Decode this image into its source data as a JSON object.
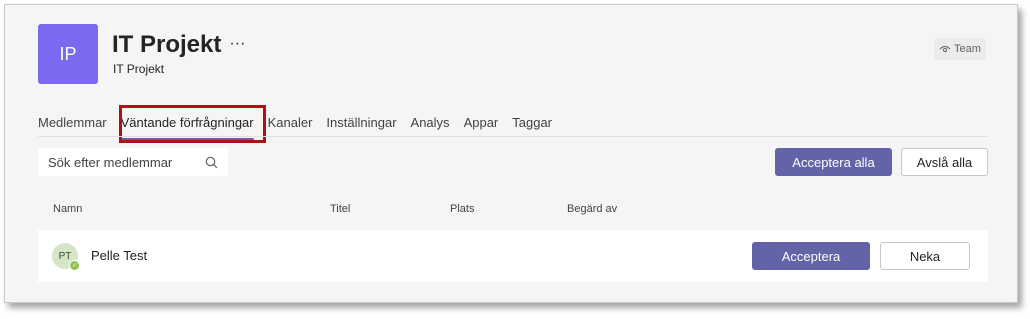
{
  "team": {
    "initials": "IP",
    "title": "IT Projekt",
    "more": "···",
    "subtitle": "IT Projekt",
    "badge": "Team",
    "badge_icon": "eye-icon"
  },
  "tabs": [
    {
      "label": "Medlemmar"
    },
    {
      "label": "Väntande förfrågningar",
      "active": true
    },
    {
      "label": "Kanaler"
    },
    {
      "label": "Inställningar"
    },
    {
      "label": "Analys"
    },
    {
      "label": "Appar"
    },
    {
      "label": "Taggar"
    }
  ],
  "search": {
    "placeholder": "Sök efter medlemmar",
    "icon": "search-icon"
  },
  "actions": {
    "accept_all": "Acceptera alla",
    "decline_all": "Avslå alla"
  },
  "columns": [
    "Namn",
    "Titel",
    "Plats",
    "Begärd av"
  ],
  "requests": [
    {
      "initials": "PT",
      "name": "Pelle Test",
      "status": "available",
      "accept": "Acceptera",
      "deny": "Neka"
    }
  ],
  "colors": {
    "accent": "#6264a7",
    "highlight": "#b01212",
    "avatar": "#7b69f0"
  }
}
